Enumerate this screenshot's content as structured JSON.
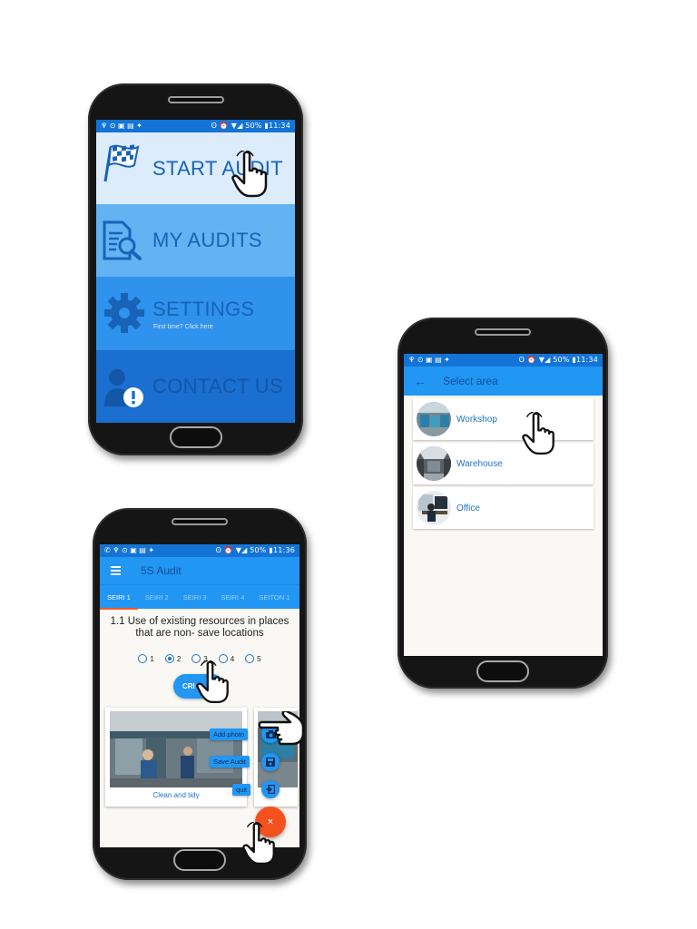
{
  "status_bar_main": {
    "left_icons": "♆ ⊙ ▣ ▤ ✦",
    "right_text": "ʘ ⏰ ▼◢ 50% ▮11:34"
  },
  "status_bar_area": {
    "left_icons": "♆ ⊙ ▣ ▤ ✦",
    "right_text": "ʘ ⏰ ▼◢ 50% ▮11:34"
  },
  "status_bar_audit": {
    "left_icons": "✆ ♆ ⊙ ▣ ▤ ✦",
    "right_text": "ʘ ⏰ ▼◢ 50% ▮11:36"
  },
  "main_menu": {
    "items": [
      {
        "label": "START AUDIT",
        "icon": "checkered-flag-icon",
        "bg": "#dcecfa"
      },
      {
        "label": "MY AUDITS",
        "icon": "document-search-icon",
        "bg": "#63b2f2"
      },
      {
        "label": "SETTINGS",
        "sublabel": "First time? Click here",
        "icon": "gear-icon",
        "bg": "#2f92ec"
      },
      {
        "label": "CONTACT US",
        "icon": "user-alert-icon",
        "bg": "#1a6fd0"
      }
    ]
  },
  "select_area": {
    "title": "Select area",
    "areas": [
      {
        "label": "Workshop"
      },
      {
        "label": "Warehouse"
      },
      {
        "label": "Office"
      }
    ]
  },
  "audit": {
    "title": "5S Audit",
    "tabs": [
      "SEIRI 1",
      "SEIRI 2",
      "SEIRI 3",
      "SEIRI 4",
      "SEITON 1"
    ],
    "active_tab": 0,
    "question": "1.1 Use of existing resources in places that are non- save locations",
    "rating_options": [
      "1",
      "2",
      "3",
      "4",
      "5"
    ],
    "selected_rating": "2",
    "criteria_button": "CRI",
    "photo_caption": "Clean and tidy",
    "fab_actions": [
      {
        "label": "Add photo",
        "icon": "camera-icon"
      },
      {
        "label": "Save Audit",
        "icon": "save-icon"
      },
      {
        "label": "quit",
        "icon": "exit-icon"
      }
    ],
    "main_fab_icon": "×"
  },
  "colors": {
    "primary": "#2196f3",
    "dark_text": "#1763b8",
    "accent": "#f4511e"
  }
}
